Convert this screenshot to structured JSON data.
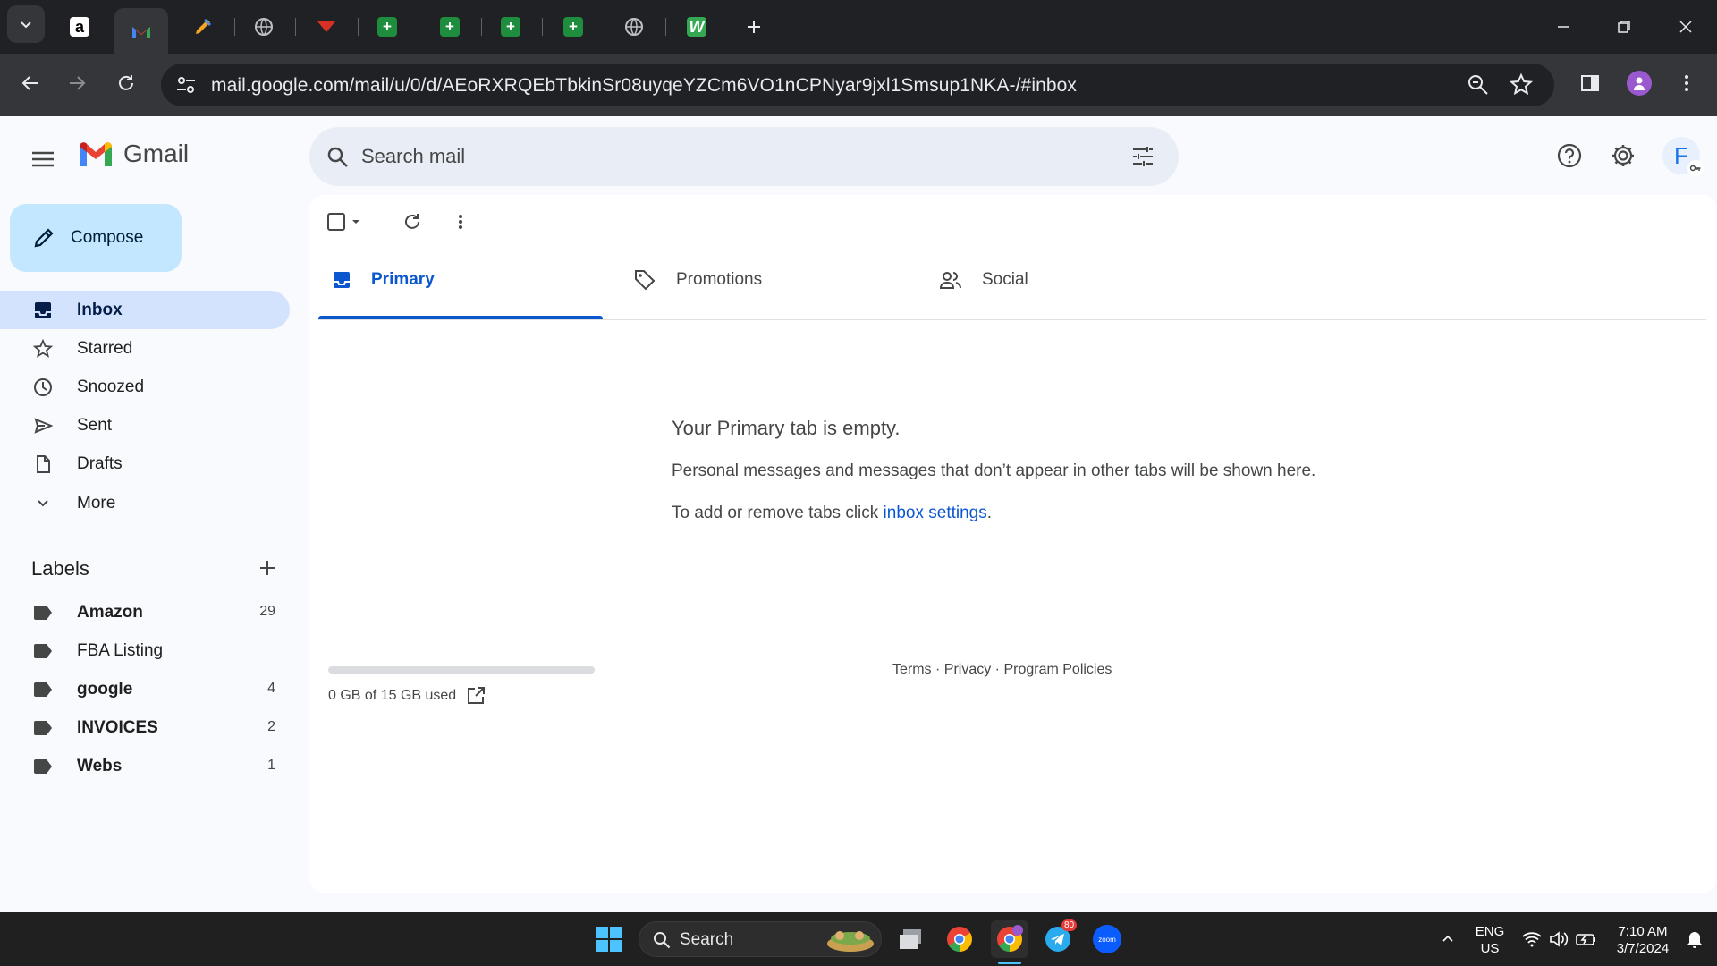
{
  "browser": {
    "url": "mail.google.com/mail/u/0/d/AEoRXRQEbTbkinSr08uyqeYZCm6VO1nCPNyar9jxl1Smsup1NKA-/#inbox",
    "tabs": [
      {
        "icon": "amazon-icon"
      },
      {
        "icon": "gmail-icon"
      },
      {
        "icon": "pencil-app-icon"
      },
      {
        "icon": "globe-icon"
      },
      {
        "icon": "red-site-icon"
      },
      {
        "icon": "sheets-icon"
      },
      {
        "icon": "sheets-icon"
      },
      {
        "icon": "sheets-icon"
      },
      {
        "icon": "sheets-icon"
      },
      {
        "icon": "globe-icon"
      },
      {
        "icon": "w-app-icon"
      }
    ]
  },
  "gmail": {
    "logo_text": "Gmail",
    "search_placeholder": "Search mail",
    "account_initial": "F",
    "compose_label": "Compose",
    "nav": [
      {
        "label": "Inbox",
        "icon": "inbox-icon",
        "active": true
      },
      {
        "label": "Starred",
        "icon": "star-icon"
      },
      {
        "label": "Snoozed",
        "icon": "clock-icon"
      },
      {
        "label": "Sent",
        "icon": "send-icon"
      },
      {
        "label": "Drafts",
        "icon": "draft-icon"
      },
      {
        "label": "More",
        "icon": "chevron-down-icon"
      }
    ],
    "labels_title": "Labels",
    "labels": [
      {
        "name": "Amazon",
        "count": "29",
        "bold": true
      },
      {
        "name": "FBA Listing",
        "count": "",
        "bold": false
      },
      {
        "name": "google",
        "count": "4",
        "bold": true
      },
      {
        "name": "INVOICES",
        "count": "2",
        "bold": true
      },
      {
        "name": "Webs",
        "count": "1",
        "bold": true
      }
    ],
    "category_tabs": [
      {
        "label": "Primary",
        "icon": "inbox-tab-icon",
        "active": true
      },
      {
        "label": "Promotions",
        "icon": "tag-icon"
      },
      {
        "label": "Social",
        "icon": "people-icon"
      }
    ],
    "empty": {
      "title": "Your Primary tab is empty.",
      "description": "Personal messages and messages that don’t appear in other tabs will be shown here.",
      "hint_prefix": "To add or remove tabs click ",
      "hint_link": "inbox settings",
      "hint_suffix": "."
    },
    "storage": {
      "text": "0 GB of 15 GB used",
      "fraction_used": 0
    },
    "footer": {
      "terms": "Terms",
      "privacy": "Privacy",
      "policies": "Program Policies",
      "separator": " · "
    }
  },
  "taskbar": {
    "search_label": "Search",
    "lang_top": "ENG",
    "lang_bottom": "US",
    "time": "7:10 AM",
    "date": "3/7/2024",
    "telegram_badge": "80",
    "zoom_label": "zoom"
  }
}
